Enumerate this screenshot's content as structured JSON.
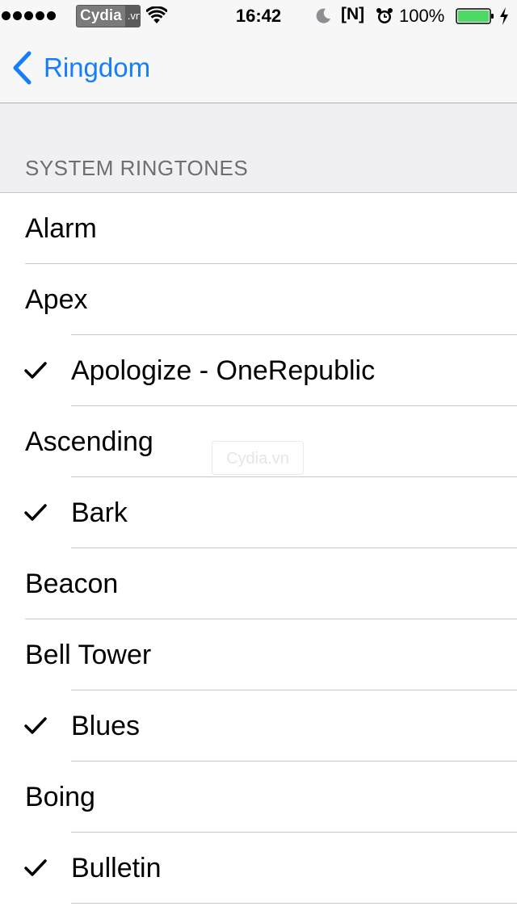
{
  "status_bar": {
    "signal_icon": "signal-dots-icon",
    "carrier_badge": "Cydia",
    "carrier_badge_suffix": ".vn",
    "wifi_icon": "wifi-icon",
    "time": "16:42",
    "moon_icon": "do-not-disturb-moon-icon",
    "indicator": "[N]",
    "alarm_icon": "alarm-clock-icon",
    "battery_percent": "100%",
    "battery_level": 1.0,
    "battery_color": "#4cd964",
    "charging_icon": "charging-bolt-icon"
  },
  "nav": {
    "back_icon": "chevron-left-icon",
    "back_label": "Ringdom",
    "accent_color": "#147efb"
  },
  "section": {
    "header": "SYSTEM RINGTONES"
  },
  "ringtones": [
    {
      "label": "Alarm",
      "checked": false
    },
    {
      "label": "Apex",
      "checked": false
    },
    {
      "label": "Apologize - OneRepublic",
      "checked": true
    },
    {
      "label": "Ascending",
      "checked": false
    },
    {
      "label": "Bark",
      "checked": true
    },
    {
      "label": "Beacon",
      "checked": false
    },
    {
      "label": "Bell Tower",
      "checked": false
    },
    {
      "label": "Blues",
      "checked": true
    },
    {
      "label": "Boing",
      "checked": false
    },
    {
      "label": "Bulletin",
      "checked": true
    }
  ],
  "watermark": {
    "brand": "Cydia",
    "suffix": ".vn"
  }
}
